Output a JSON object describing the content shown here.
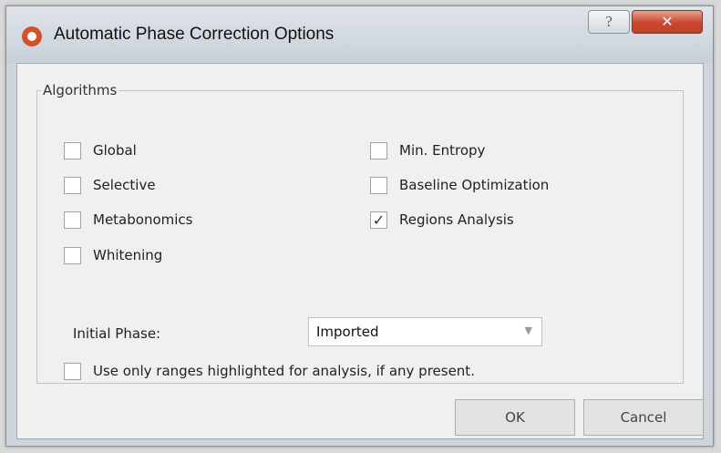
{
  "window": {
    "title": "Automatic Phase Correction Options",
    "help_glyph": "?",
    "close_glyph": "✕"
  },
  "algorithms": {
    "group_label": "Algorithms",
    "check_mark": "✓",
    "options": [
      {
        "label": "Global",
        "checked": false
      },
      {
        "label": "Selective",
        "checked": false
      },
      {
        "label": "Metabonomics",
        "checked": false
      },
      {
        "label": "Whitening",
        "checked": false
      },
      {
        "label": "Min. Entropy",
        "checked": false
      },
      {
        "label": "Baseline Optimization",
        "checked": false
      },
      {
        "label": "Regions Analysis",
        "checked": true
      }
    ]
  },
  "initial_phase": {
    "label": "Initial Phase:",
    "value": "Imported",
    "arrow_glyph": "▼"
  },
  "ranges_option": {
    "label": "Use only ranges highlighted for analysis, if any present.",
    "checked": false
  },
  "buttons": {
    "ok": "OK",
    "cancel": "Cancel"
  },
  "colors": {
    "accent_close": "#c9462e",
    "app_icon": "#d4502a"
  }
}
